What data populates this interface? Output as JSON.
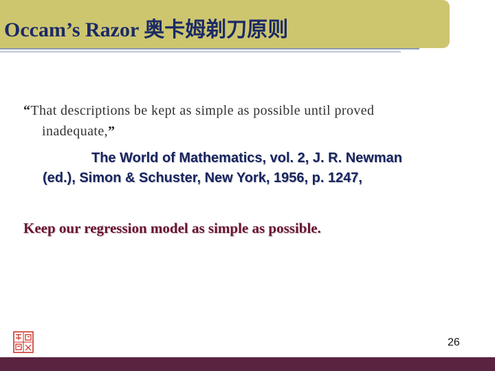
{
  "slide": {
    "title": "Occam’s Razor 奥卡姆剃刀原则",
    "quote": {
      "open_mark": "“",
      "line1": "That descriptions be kept as simple as possible until proved",
      "line2": "inadequate,",
      "close_mark": "”"
    },
    "citation": {
      "line1": "The World of Mathematics, vol. 2, J. R. Newman",
      "line2": "(ed.), Simon & Schuster, New York, 1956, p. 1247,"
    },
    "takeaway": "Keep our regression model as simple as possible.",
    "page_number": "26",
    "seal_icon": "red-seal-icon",
    "colors": {
      "title_bar": "#cdc66f",
      "title_text": "#1c2a66",
      "citation_text": "#17245e",
      "takeaway_text": "#6b1433",
      "bottom_bar": "#5a2340"
    }
  }
}
